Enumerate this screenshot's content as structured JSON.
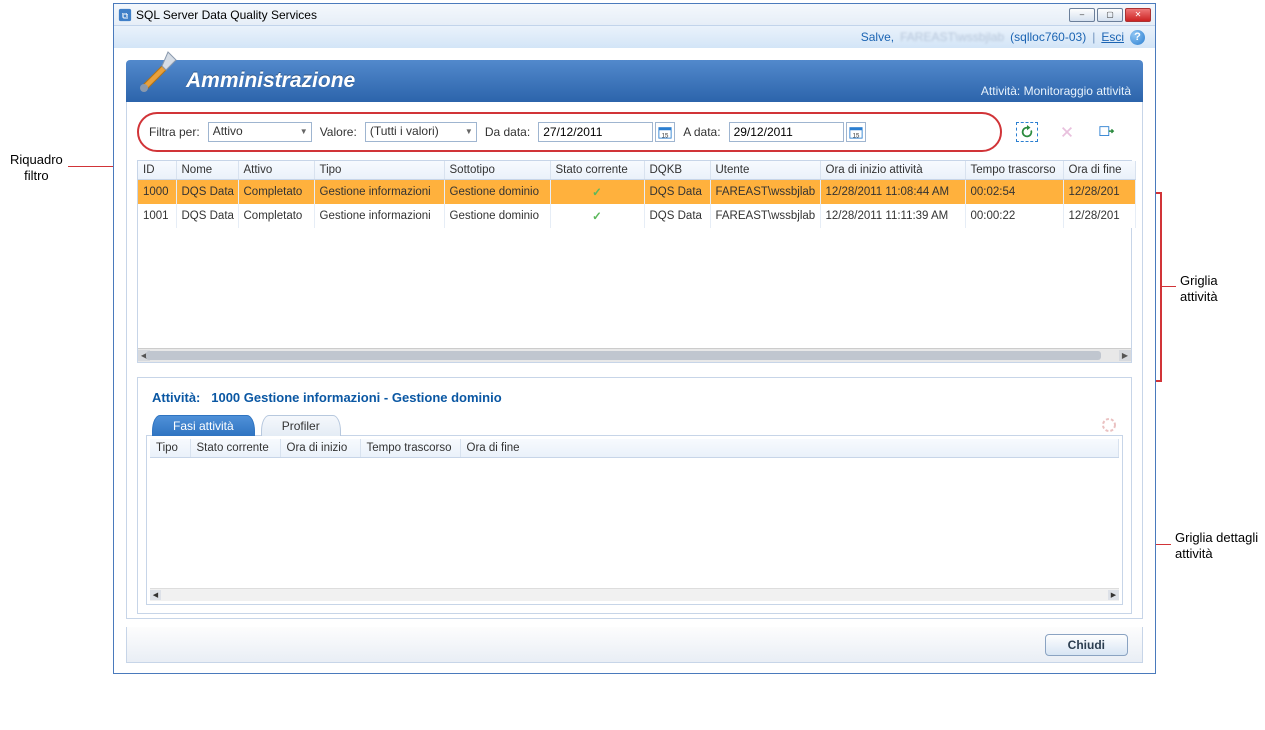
{
  "annotations": {
    "filter_pane": "Riquadro\nfiltro",
    "activity_grid": "Griglia\nattività",
    "activity_detail_grid": "Griglia dettagli\nattività"
  },
  "window": {
    "title": "SQL Server Data Quality Services",
    "minimize": "–",
    "maximize": "▢",
    "close": "✕"
  },
  "welcome": {
    "salve": "Salve,",
    "user_obscured": "FAREAST\\wssbjlab",
    "server": "(sqlloc760-03)",
    "divider": "|",
    "exit": "Esci",
    "help": "?"
  },
  "banner": {
    "title": "Amministrazione",
    "subtitle_label": "Attività:",
    "subtitle_value": "Monitoraggio attività"
  },
  "filter": {
    "filter_by_label": "Filtra per:",
    "filter_by_value": "Attivo",
    "value_label": "Valore:",
    "value_value": "(Tutti i valori)",
    "from_date_label": "Da data:",
    "from_date_value": "27/12/2011",
    "to_date_label": "A data:",
    "to_date_value": "29/12/2011"
  },
  "grid": {
    "headers": {
      "id": "ID",
      "name": "Nome",
      "active": "Attivo",
      "type": "Tipo",
      "subtype": "Sottotipo",
      "current_state": "Stato corrente",
      "dqkb": "DQKB",
      "user": "Utente",
      "start_time": "Ora di inizio attività",
      "elapsed": "Tempo trascorso",
      "end_time": "Ora di fine"
    },
    "rows": [
      {
        "id": "1000",
        "name": "DQS Data",
        "active": "Completato",
        "type": "Gestione informazioni",
        "subtype": "Gestione dominio",
        "state_check": "✓",
        "dqkb": "DQS Data",
        "user": "FAREAST\\wssbjlab",
        "start": "12/28/2011 11:08:44 AM",
        "elapsed": "00:02:54",
        "end": "12/28/201"
      },
      {
        "id": "1001",
        "name": "DQS Data",
        "active": "Completato",
        "type": "Gestione informazioni",
        "subtype": "Gestione dominio",
        "state_check": "✓",
        "dqkb": "DQS Data",
        "user": "FAREAST\\wssbjlab",
        "start": "12/28/2011 11:11:39 AM",
        "elapsed": "00:00:22",
        "end": "12/28/201"
      }
    ]
  },
  "detail": {
    "title_prefix": "Attività:",
    "title_id": "1000 Gestione informazioni",
    "title_sep": "-",
    "title_sub": "Gestione dominio",
    "tabs": {
      "phases": "Fasi attività",
      "profiler": "Profiler"
    },
    "headers": {
      "type": "Tipo",
      "current_state": "Stato corrente",
      "start": "Ora di inizio",
      "elapsed": "Tempo trascorso",
      "end": "Ora di fine"
    }
  },
  "footer": {
    "close": "Chiudi"
  }
}
